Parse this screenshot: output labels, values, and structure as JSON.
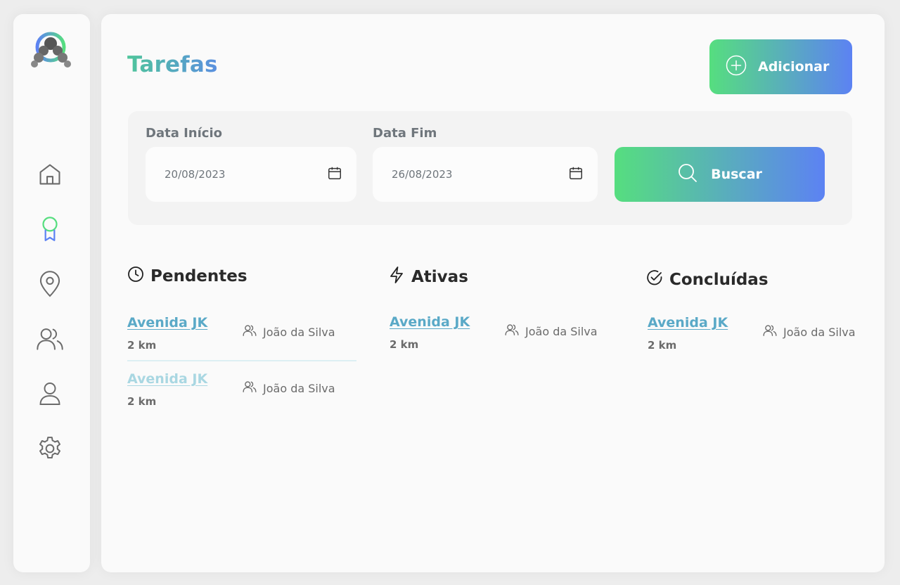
{
  "sidebar": {
    "items": [
      {
        "name": "home",
        "icon": "home-icon",
        "active": false
      },
      {
        "name": "tasks",
        "icon": "award-ribbon-icon",
        "active": true
      },
      {
        "name": "locations",
        "icon": "map-pin-icon",
        "active": false
      },
      {
        "name": "teams",
        "icon": "users-icon",
        "active": false
      },
      {
        "name": "profile",
        "icon": "user-icon",
        "active": false
      },
      {
        "name": "settings",
        "icon": "gear-icon",
        "active": false
      }
    ]
  },
  "header": {
    "title": "Tarefas",
    "add_label": "Adicionar"
  },
  "filter": {
    "start_label": "Data Início",
    "start_value": "20/08/2023",
    "end_label": "Data Fim",
    "end_value": "26/08/2023",
    "search_label": "Buscar"
  },
  "columns": [
    {
      "title": "Pendentes",
      "icon": "clock-icon",
      "tasks": [
        {
          "street": "Avenida JK",
          "distance": "2 km",
          "assignee": "João da Silva"
        },
        {
          "street": "Avenida JK",
          "distance": "2 km",
          "assignee": "João da Silva"
        }
      ]
    },
    {
      "title": "Ativas",
      "icon": "lightning-icon",
      "tasks": [
        {
          "street": "Avenida JK",
          "distance": "2 km",
          "assignee": "João da Silva"
        }
      ]
    },
    {
      "title": "Concluídas",
      "icon": "check-circle-icon",
      "tasks": [
        {
          "street": "Avenida JK",
          "distance": "2 km",
          "assignee": "João da Silva"
        }
      ]
    }
  ],
  "colors": {
    "accent_green": "#56de7f",
    "accent_blue": "#5c82f3",
    "link": "#5aa9c7"
  }
}
